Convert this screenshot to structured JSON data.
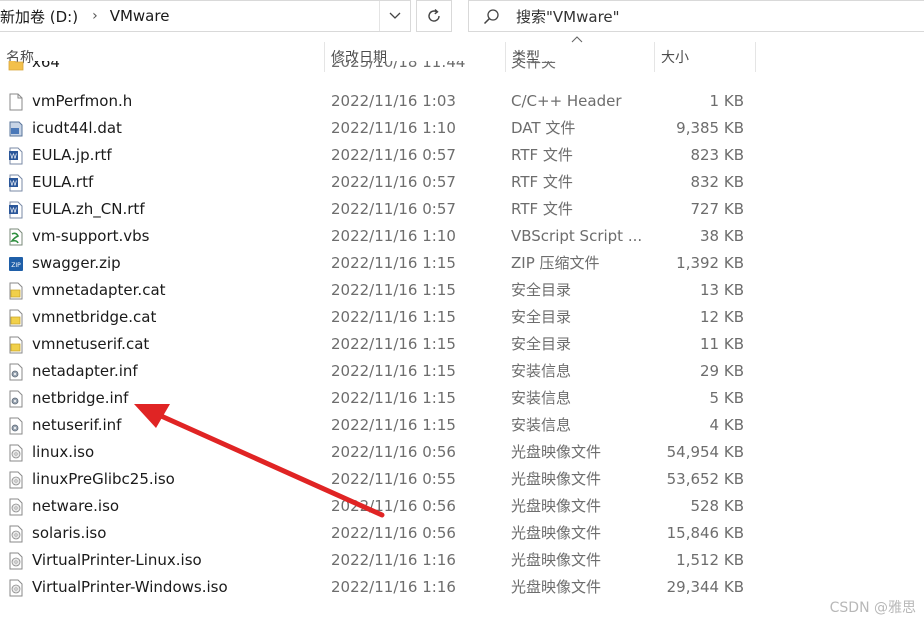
{
  "address": {
    "drive": "新加卷 (D:)",
    "folder": "VMware"
  },
  "search": {
    "placeholder": "搜索\"VMware\""
  },
  "columns": {
    "name": "名称",
    "date": "修改日期",
    "type": "类型",
    "size": "大小"
  },
  "files": [
    {
      "name": "x64",
      "date": "2025/10/18 11:44",
      "type": "文件夹",
      "size": "",
      "icon": "folder-icon"
    },
    {
      "name": "vmPerfmon.h",
      "date": "2022/11/16 1:03",
      "type": "C/C++ Header",
      "size": "1 KB",
      "icon": "header-file-icon"
    },
    {
      "name": "icudt44l.dat",
      "date": "2022/11/16 1:10",
      "type": "DAT 文件",
      "size": "9,385 KB",
      "icon": "dat-file-icon"
    },
    {
      "name": "EULA.jp.rtf",
      "date": "2022/11/16 0:57",
      "type": "RTF 文件",
      "size": "823 KB",
      "icon": "word-document-icon"
    },
    {
      "name": "EULA.rtf",
      "date": "2022/11/16 0:57",
      "type": "RTF 文件",
      "size": "832 KB",
      "icon": "word-document-icon"
    },
    {
      "name": "EULA.zh_CN.rtf",
      "date": "2022/11/16 0:57",
      "type": "RTF 文件",
      "size": "727 KB",
      "icon": "word-document-icon"
    },
    {
      "name": "vm-support.vbs",
      "date": "2022/11/16 1:10",
      "type": "VBScript Script ...",
      "size": "38 KB",
      "icon": "vbscript-icon"
    },
    {
      "name": "swagger.zip",
      "date": "2022/11/16 1:15",
      "type": "ZIP 压缩文件",
      "size": "1,392 KB",
      "icon": "zip-archive-icon"
    },
    {
      "name": "vmnetadapter.cat",
      "date": "2022/11/16 1:15",
      "type": "安全目录",
      "size": "13 KB",
      "icon": "security-catalog-icon"
    },
    {
      "name": "vmnetbridge.cat",
      "date": "2022/11/16 1:15",
      "type": "安全目录",
      "size": "12 KB",
      "icon": "security-catalog-icon"
    },
    {
      "name": "vmnetuserif.cat",
      "date": "2022/11/16 1:15",
      "type": "安全目录",
      "size": "11 KB",
      "icon": "security-catalog-icon"
    },
    {
      "name": "netadapter.inf",
      "date": "2022/11/16 1:15",
      "type": "安装信息",
      "size": "29 KB",
      "icon": "setup-info-icon"
    },
    {
      "name": "netbridge.inf",
      "date": "2022/11/16 1:15",
      "type": "安装信息",
      "size": "5 KB",
      "icon": "setup-info-icon"
    },
    {
      "name": "netuserif.inf",
      "date": "2022/11/16 1:15",
      "type": "安装信息",
      "size": "4 KB",
      "icon": "setup-info-icon"
    },
    {
      "name": "linux.iso",
      "date": "2022/11/16 0:56",
      "type": "光盘映像文件",
      "size": "54,954 KB",
      "icon": "disc-image-icon"
    },
    {
      "name": "linuxPreGlibc25.iso",
      "date": "2022/11/16 0:55",
      "type": "光盘映像文件",
      "size": "53,652 KB",
      "icon": "disc-image-icon"
    },
    {
      "name": "netware.iso",
      "date": "2022/11/16 0:56",
      "type": "光盘映像文件",
      "size": "528 KB",
      "icon": "disc-image-icon"
    },
    {
      "name": "solaris.iso",
      "date": "2022/11/16 0:56",
      "type": "光盘映像文件",
      "size": "15,846 KB",
      "icon": "disc-image-icon"
    },
    {
      "name": "VirtualPrinter-Linux.iso",
      "date": "2022/11/16 1:16",
      "type": "光盘映像文件",
      "size": "1,512 KB",
      "icon": "disc-image-icon"
    },
    {
      "name": "VirtualPrinter-Windows.iso",
      "date": "2022/11/16 1:16",
      "type": "光盘映像文件",
      "size": "29,344 KB",
      "icon": "disc-image-icon"
    }
  ],
  "annotation": {
    "color": "#e02424",
    "target": "netbridge.inf"
  },
  "watermark": "CSDN @雅思"
}
